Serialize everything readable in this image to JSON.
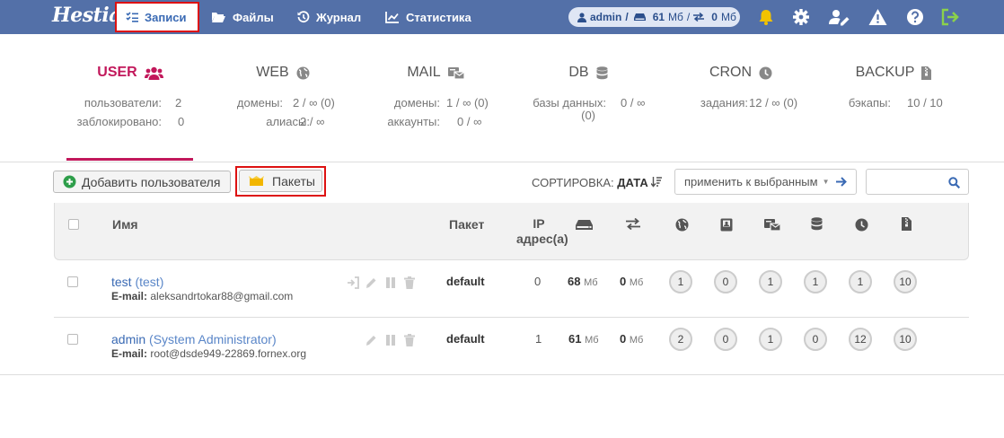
{
  "brand": "Hestia",
  "nav": {
    "records": "Записи",
    "files": "Файлы",
    "log": "Журнал",
    "stats": "Статистика"
  },
  "account": {
    "user": "admin",
    "sep": "/",
    "disk": "61",
    "disk_unit": "Мб",
    "bw": "0",
    "bw_unit": "Мб"
  },
  "stats": {
    "user": {
      "title": "USER",
      "rows": [
        {
          "label": "пользователи:",
          "value": "2"
        },
        {
          "label": "заблокировано:",
          "value": "0"
        }
      ]
    },
    "web": {
      "title": "WEB",
      "rows": [
        {
          "label": "домены:",
          "value": "2 / ∞ (0)"
        },
        {
          "label": "алиасы:",
          "value": "2 / ∞"
        }
      ]
    },
    "mail": {
      "title": "MAIL",
      "rows": [
        {
          "label": "домены:",
          "value": "1 / ∞ (0)"
        },
        {
          "label": "аккаунты:",
          "value": "0 / ∞"
        }
      ]
    },
    "db": {
      "title": "DB",
      "rows": [
        {
          "label": "базы данных:",
          "label2": "(0)",
          "value": "0 / ∞"
        }
      ]
    },
    "cron": {
      "title": "CRON",
      "rows": [
        {
          "label": "задания:",
          "value": "12 / ∞ (0)"
        }
      ]
    },
    "backup": {
      "title": "BACKUP",
      "rows": [
        {
          "label": "бэкапы:",
          "value": "10 / 10"
        }
      ]
    }
  },
  "toolbar": {
    "add_user": "Добавить пользователя",
    "packages": "Пакеты",
    "sort_label": "СОРТИРОВКА:",
    "sort_value": "ДАТА",
    "bulk_placeholder": "применить к выбранным"
  },
  "table": {
    "col_name": "Имя",
    "col_package": "Пакет",
    "col_ip_1": "IP",
    "col_ip_2": "адрес(а)",
    "rows": [
      {
        "user": "test",
        "full": "(test)",
        "email_label": "E-mail:",
        "email": "aleksandrtokar88@gmail.com",
        "package": "default",
        "ip": "0",
        "disk": "68",
        "disk_unit": "Мб",
        "bw": "0",
        "bw_unit": "Мб",
        "counts": [
          "1",
          "0",
          "1",
          "1",
          "1",
          "10"
        ]
      },
      {
        "user": "admin",
        "full": "(System Administrator)",
        "email_label": "E-mail:",
        "email": "root@dsde949-22869.fornex.org",
        "package": "default",
        "ip": "1",
        "disk": "61",
        "disk_unit": "Мб",
        "bw": "0",
        "bw_unit": "Мб",
        "counts": [
          "2",
          "0",
          "1",
          "0",
          "12",
          "10"
        ]
      }
    ]
  },
  "colors": {
    "topbar": "#5370a8",
    "accent": "#c2185b",
    "link": "#3a6ab4",
    "bell": "#f2c200",
    "logout": "#8bd14b",
    "add": "#2e9e4a",
    "packages_icon": "#f2b600"
  }
}
